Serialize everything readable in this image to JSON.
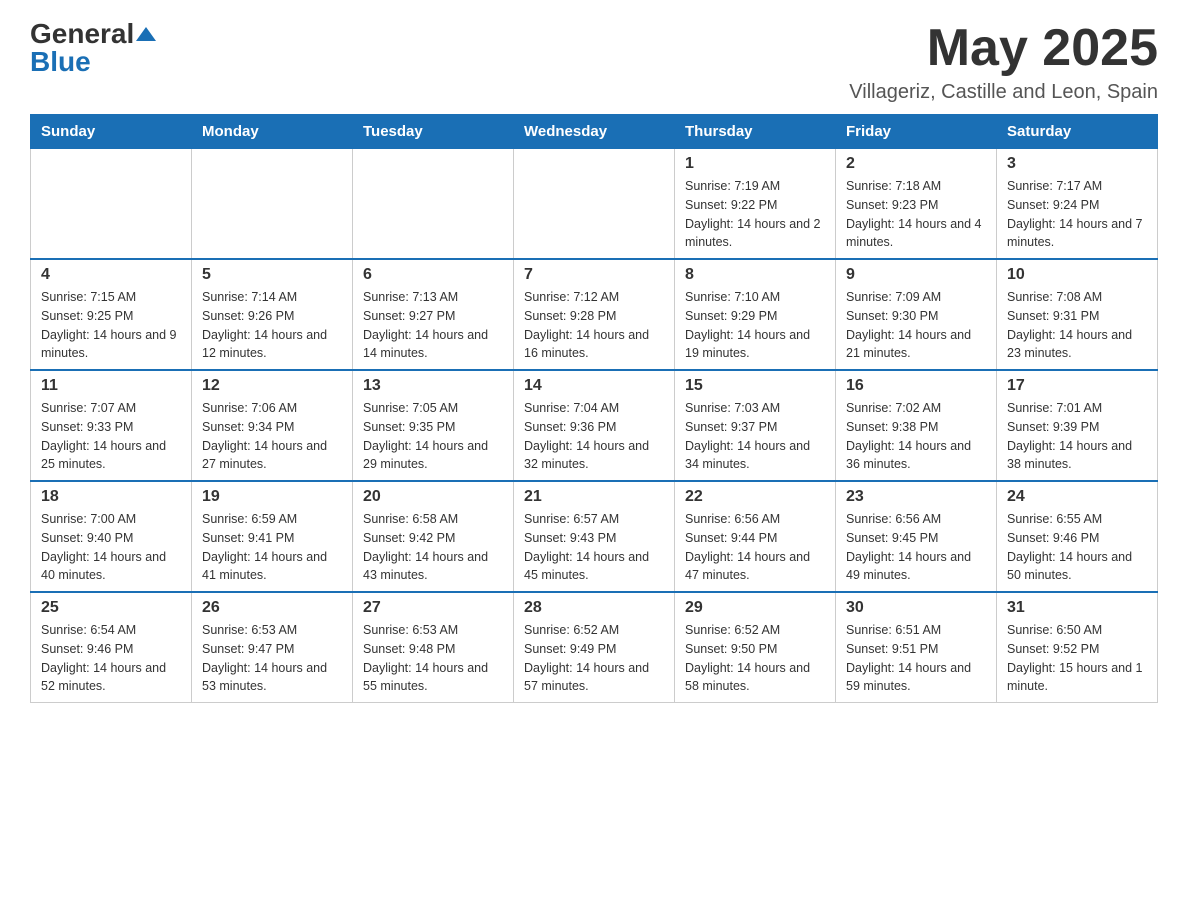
{
  "header": {
    "logo_general": "General",
    "logo_blue": "Blue",
    "month_title": "May 2025",
    "location": "Villageriz, Castille and Leon, Spain"
  },
  "weekdays": [
    "Sunday",
    "Monday",
    "Tuesday",
    "Wednesday",
    "Thursday",
    "Friday",
    "Saturday"
  ],
  "weeks": [
    [
      {
        "day": "",
        "info": ""
      },
      {
        "day": "",
        "info": ""
      },
      {
        "day": "",
        "info": ""
      },
      {
        "day": "",
        "info": ""
      },
      {
        "day": "1",
        "info": "Sunrise: 7:19 AM\nSunset: 9:22 PM\nDaylight: 14 hours and 2 minutes."
      },
      {
        "day": "2",
        "info": "Sunrise: 7:18 AM\nSunset: 9:23 PM\nDaylight: 14 hours and 4 minutes."
      },
      {
        "day": "3",
        "info": "Sunrise: 7:17 AM\nSunset: 9:24 PM\nDaylight: 14 hours and 7 minutes."
      }
    ],
    [
      {
        "day": "4",
        "info": "Sunrise: 7:15 AM\nSunset: 9:25 PM\nDaylight: 14 hours and 9 minutes."
      },
      {
        "day": "5",
        "info": "Sunrise: 7:14 AM\nSunset: 9:26 PM\nDaylight: 14 hours and 12 minutes."
      },
      {
        "day": "6",
        "info": "Sunrise: 7:13 AM\nSunset: 9:27 PM\nDaylight: 14 hours and 14 minutes."
      },
      {
        "day": "7",
        "info": "Sunrise: 7:12 AM\nSunset: 9:28 PM\nDaylight: 14 hours and 16 minutes."
      },
      {
        "day": "8",
        "info": "Sunrise: 7:10 AM\nSunset: 9:29 PM\nDaylight: 14 hours and 19 minutes."
      },
      {
        "day": "9",
        "info": "Sunrise: 7:09 AM\nSunset: 9:30 PM\nDaylight: 14 hours and 21 minutes."
      },
      {
        "day": "10",
        "info": "Sunrise: 7:08 AM\nSunset: 9:31 PM\nDaylight: 14 hours and 23 minutes."
      }
    ],
    [
      {
        "day": "11",
        "info": "Sunrise: 7:07 AM\nSunset: 9:33 PM\nDaylight: 14 hours and 25 minutes."
      },
      {
        "day": "12",
        "info": "Sunrise: 7:06 AM\nSunset: 9:34 PM\nDaylight: 14 hours and 27 minutes."
      },
      {
        "day": "13",
        "info": "Sunrise: 7:05 AM\nSunset: 9:35 PM\nDaylight: 14 hours and 29 minutes."
      },
      {
        "day": "14",
        "info": "Sunrise: 7:04 AM\nSunset: 9:36 PM\nDaylight: 14 hours and 32 minutes."
      },
      {
        "day": "15",
        "info": "Sunrise: 7:03 AM\nSunset: 9:37 PM\nDaylight: 14 hours and 34 minutes."
      },
      {
        "day": "16",
        "info": "Sunrise: 7:02 AM\nSunset: 9:38 PM\nDaylight: 14 hours and 36 minutes."
      },
      {
        "day": "17",
        "info": "Sunrise: 7:01 AM\nSunset: 9:39 PM\nDaylight: 14 hours and 38 minutes."
      }
    ],
    [
      {
        "day": "18",
        "info": "Sunrise: 7:00 AM\nSunset: 9:40 PM\nDaylight: 14 hours and 40 minutes."
      },
      {
        "day": "19",
        "info": "Sunrise: 6:59 AM\nSunset: 9:41 PM\nDaylight: 14 hours and 41 minutes."
      },
      {
        "day": "20",
        "info": "Sunrise: 6:58 AM\nSunset: 9:42 PM\nDaylight: 14 hours and 43 minutes."
      },
      {
        "day": "21",
        "info": "Sunrise: 6:57 AM\nSunset: 9:43 PM\nDaylight: 14 hours and 45 minutes."
      },
      {
        "day": "22",
        "info": "Sunrise: 6:56 AM\nSunset: 9:44 PM\nDaylight: 14 hours and 47 minutes."
      },
      {
        "day": "23",
        "info": "Sunrise: 6:56 AM\nSunset: 9:45 PM\nDaylight: 14 hours and 49 minutes."
      },
      {
        "day": "24",
        "info": "Sunrise: 6:55 AM\nSunset: 9:46 PM\nDaylight: 14 hours and 50 minutes."
      }
    ],
    [
      {
        "day": "25",
        "info": "Sunrise: 6:54 AM\nSunset: 9:46 PM\nDaylight: 14 hours and 52 minutes."
      },
      {
        "day": "26",
        "info": "Sunrise: 6:53 AM\nSunset: 9:47 PM\nDaylight: 14 hours and 53 minutes."
      },
      {
        "day": "27",
        "info": "Sunrise: 6:53 AM\nSunset: 9:48 PM\nDaylight: 14 hours and 55 minutes."
      },
      {
        "day": "28",
        "info": "Sunrise: 6:52 AM\nSunset: 9:49 PM\nDaylight: 14 hours and 57 minutes."
      },
      {
        "day": "29",
        "info": "Sunrise: 6:52 AM\nSunset: 9:50 PM\nDaylight: 14 hours and 58 minutes."
      },
      {
        "day": "30",
        "info": "Sunrise: 6:51 AM\nSunset: 9:51 PM\nDaylight: 14 hours and 59 minutes."
      },
      {
        "day": "31",
        "info": "Sunrise: 6:50 AM\nSunset: 9:52 PM\nDaylight: 15 hours and 1 minute."
      }
    ]
  ]
}
